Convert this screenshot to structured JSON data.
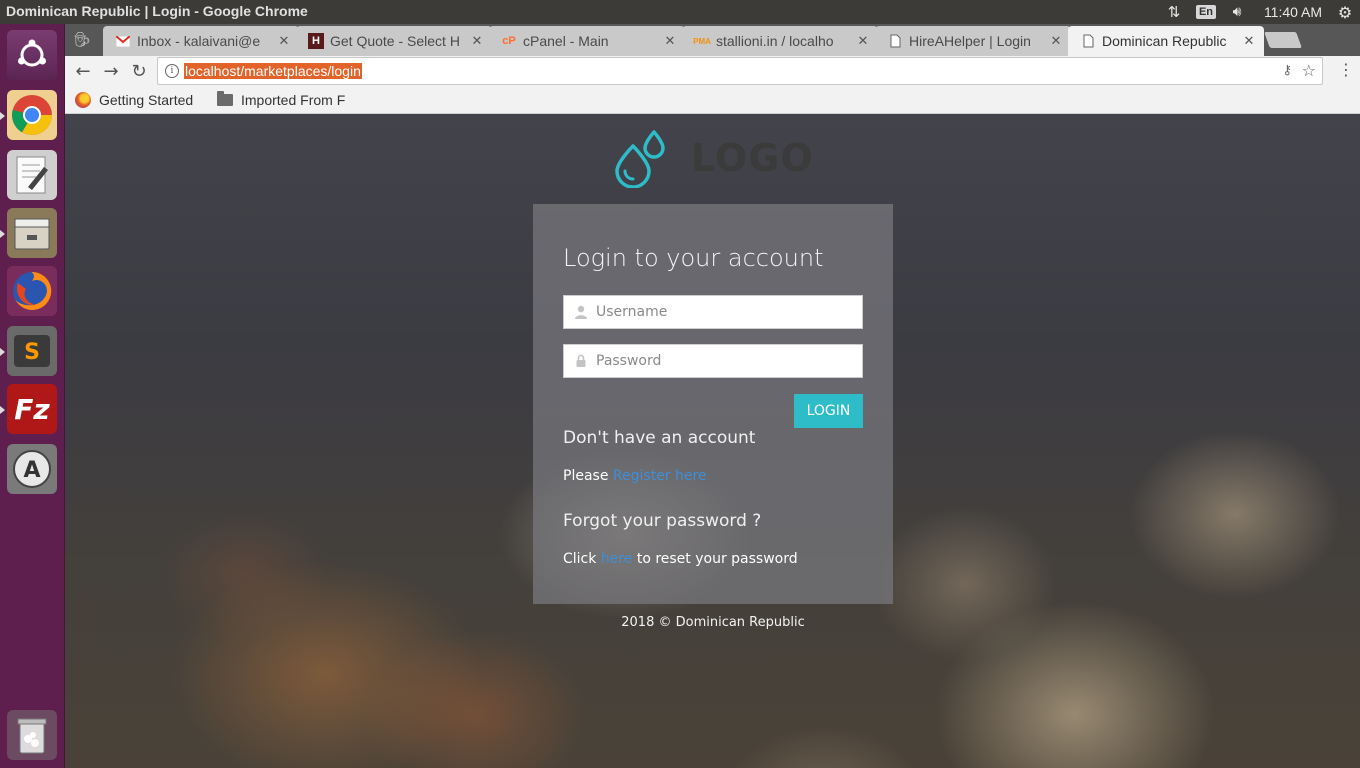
{
  "system_panel": {
    "window_title": "Dominican Republic | Login - Google Chrome",
    "language": "En",
    "clock": "11:40 AM"
  },
  "launcher": {
    "items": [
      "ubuntu-dash",
      "chrome",
      "text-editor",
      "files",
      "firefox",
      "sublime-text",
      "filezilla",
      "software-updater",
      "trash"
    ]
  },
  "browser": {
    "tabs": [
      {
        "title": "Inbox - kalaivani@e",
        "favicon": "gmail-icon",
        "active": false
      },
      {
        "title": "Get Quote - Select H",
        "favicon": "h-icon",
        "active": false
      },
      {
        "title": "cPanel - Main",
        "favicon": "cpanel-icon",
        "active": false
      },
      {
        "title": "stallioni.in / localho",
        "favicon": "phpmyadmin-icon",
        "active": false
      },
      {
        "title": "HireAHelper | Login",
        "favicon": "page-icon",
        "active": false
      },
      {
        "title": "Dominican Republic",
        "favicon": "page-icon",
        "active": true
      }
    ],
    "url": "localhost/marketplaces/login",
    "bookmarks": [
      {
        "label": "Getting Started",
        "icon": "firefox-icon"
      },
      {
        "label": "Imported From F",
        "icon": "folder-icon"
      }
    ]
  },
  "page": {
    "logo_text": "LOGO",
    "logo_color": "#2dbcc8",
    "login_heading": "Login to your account",
    "username_placeholder": "Username",
    "password_placeholder": "Password",
    "login_button": "LOGIN",
    "no_account_heading": "Don't have an account",
    "register_prefix": "Please ",
    "register_link": "Register here",
    "forgot_heading": "Forgot your password ?",
    "reset_prefix": "Click ",
    "reset_link": "here",
    "reset_suffix": " to reset your password",
    "footer": "2018 © Dominican Republic"
  }
}
